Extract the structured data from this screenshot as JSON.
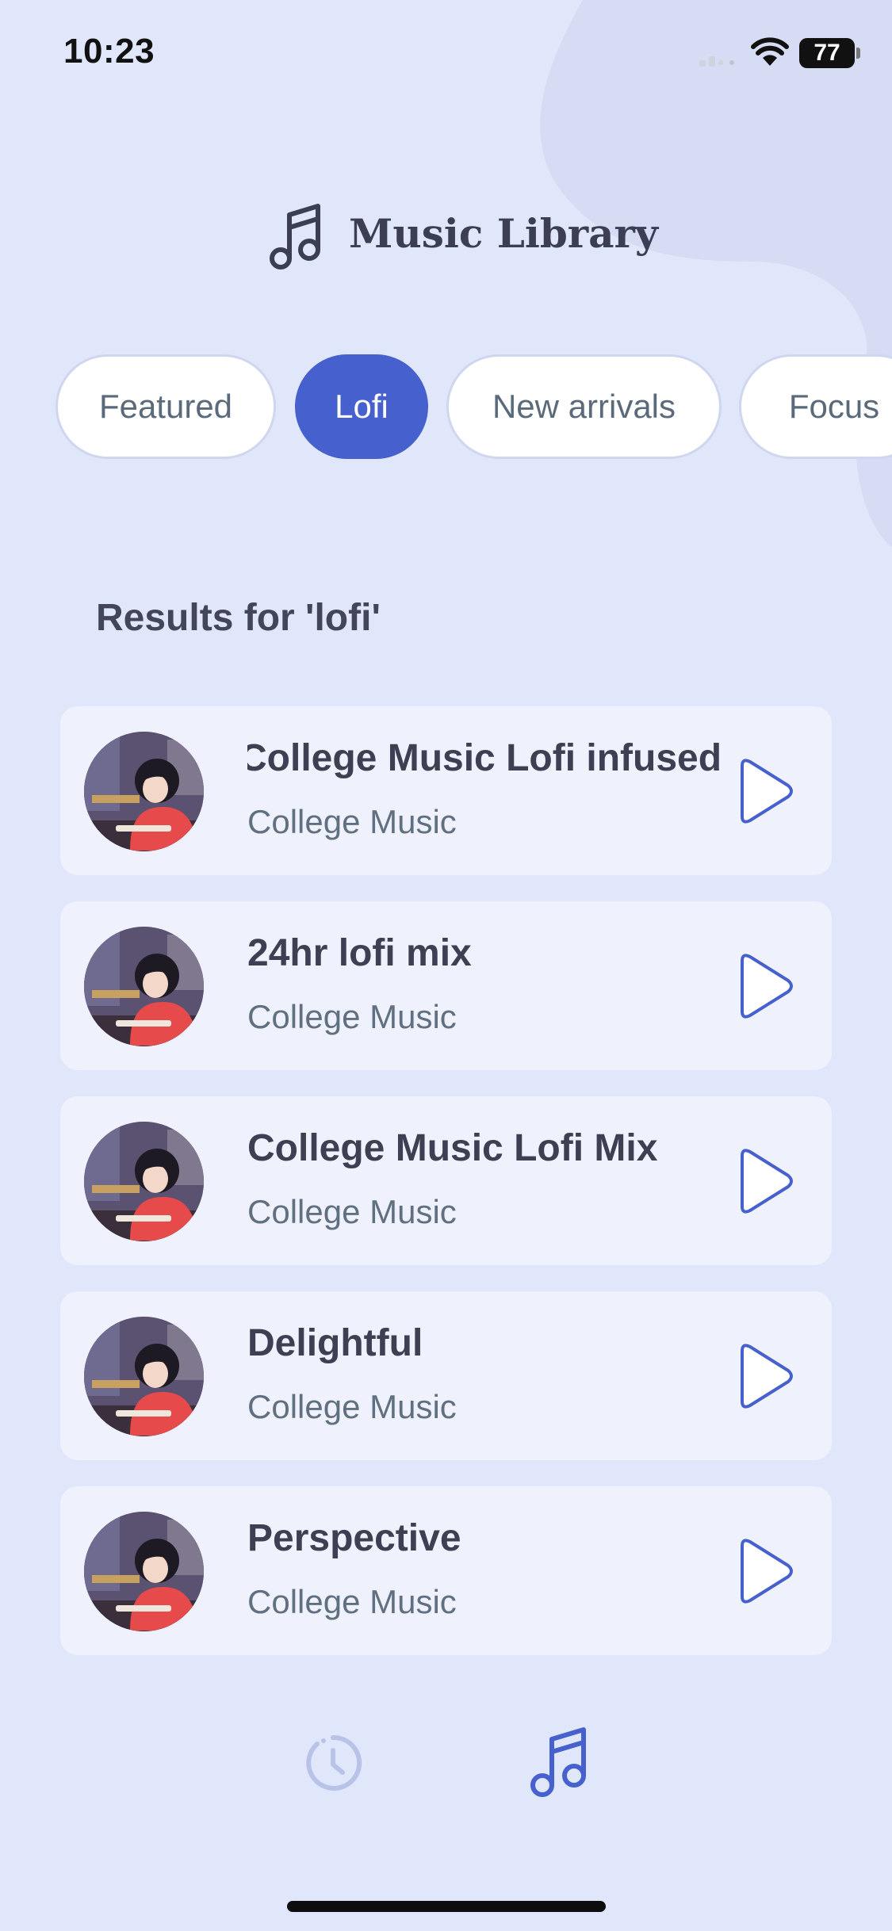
{
  "status_bar": {
    "time": "10:23",
    "battery": "77"
  },
  "header": {
    "title": "Music Library",
    "icon": "music-note-icon"
  },
  "chips": [
    {
      "label": "Featured",
      "active": false
    },
    {
      "label": "Lofi",
      "active": true
    },
    {
      "label": "New arrivals",
      "active": false
    },
    {
      "label": "Focus",
      "active": false
    }
  ],
  "results": {
    "title": "Results for 'lofi'",
    "tracks": [
      {
        "title": "College Music Lofi infused",
        "artist": "College Music"
      },
      {
        "title": "24hr lofi mix",
        "artist": "College Music"
      },
      {
        "title": "College Music Lofi Mix",
        "artist": "College Music"
      },
      {
        "title": "Delightful",
        "artist": "College Music"
      },
      {
        "title": "Perspective",
        "artist": "College Music"
      }
    ]
  },
  "nav": {
    "history_icon": "history-clock-icon",
    "music_icon": "music-note-icon"
  },
  "colors": {
    "background": "#e1e7fb",
    "accent": "#4660cd",
    "card": "#eff2fd",
    "title_text": "#3d3f52",
    "secondary_text": "#607080"
  }
}
